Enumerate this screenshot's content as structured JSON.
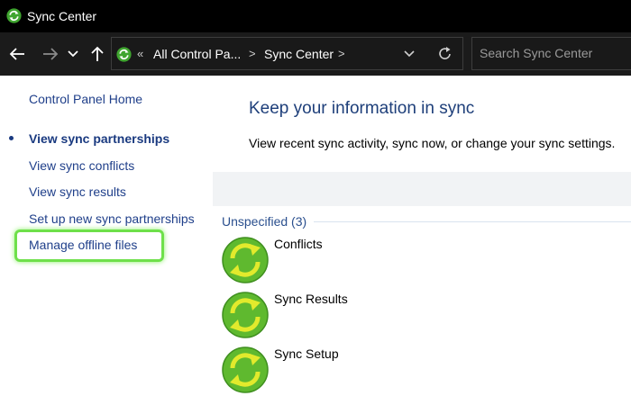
{
  "window": {
    "title": "Sync Center",
    "icon": "sync-center-icon"
  },
  "navigation": {
    "back_icon": "back-arrow-icon",
    "forward_icon": "forward-arrow-icon",
    "recent_icon": "chevron-down-icon",
    "up_icon": "up-arrow-icon",
    "breadcrumb": {
      "overflow": "«",
      "segments": [
        "All Control Pa...",
        "Sync Center"
      ],
      "separator": ">"
    },
    "dropdown_icon": "chevron-down-icon",
    "refresh_icon": "refresh-icon",
    "search_placeholder": "Search Sync Center"
  },
  "sidebar": {
    "home_link": "Control Panel Home",
    "links": [
      "View sync partnerships",
      "View sync conflicts",
      "View sync results",
      "Set up new sync partnerships",
      "Manage offline files"
    ],
    "active_index": 0,
    "highlighted_index": 4,
    "highlight_color": "#6ee04a"
  },
  "main": {
    "title": "Keep your information in sync",
    "description": "View recent sync activity, sync now, or change your sync settings.",
    "group": {
      "header": "Unspecified (3)",
      "items": [
        {
          "label": "Conflicts",
          "icon": "sync-icon"
        },
        {
          "label": "Sync Results",
          "icon": "sync-icon"
        },
        {
          "label": "Sync Setup",
          "icon": "sync-icon"
        }
      ]
    }
  },
  "colors": {
    "titlebar": "#000000",
    "navbar": "#1b1b1b",
    "link": "#1f3f8a",
    "heading": "#1e3f7a",
    "sync_green": "#5fb92f",
    "sync_yellow": "#e2ea2c"
  }
}
